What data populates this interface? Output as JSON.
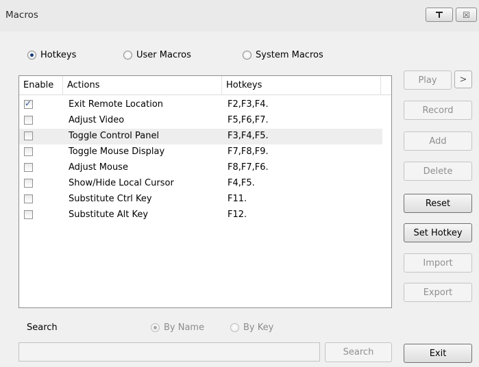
{
  "window": {
    "title": "Macros",
    "pin_icon": "pin-icon",
    "close_icon": "close-icon",
    "close_glyph": "☒"
  },
  "mode_options": [
    {
      "label": "Hotkeys",
      "selected": true
    },
    {
      "label": "User Macros",
      "selected": false
    },
    {
      "label": "System Macros",
      "selected": false
    }
  ],
  "table": {
    "headers": {
      "enable": "Enable",
      "actions": "Actions",
      "hotkeys": "Hotkeys"
    },
    "rows": [
      {
        "enabled": true,
        "action": "Exit Remote Location",
        "hotkeys": "F2,F3,F4."
      },
      {
        "enabled": false,
        "action": "Adjust Video",
        "hotkeys": "F5,F6,F7."
      },
      {
        "enabled": false,
        "action": "Toggle Control Panel",
        "hotkeys": "F3,F4,F5.",
        "highlighted": true
      },
      {
        "enabled": false,
        "action": "Toggle Mouse Display",
        "hotkeys": "F7,F8,F9."
      },
      {
        "enabled": false,
        "action": "Adjust Mouse",
        "hotkeys": "F8,F7,F6."
      },
      {
        "enabled": false,
        "action": "Show/Hide Local Cursor",
        "hotkeys": "F4,F5."
      },
      {
        "enabled": false,
        "action": "Substitute Ctrl Key",
        "hotkeys": "F11."
      },
      {
        "enabled": false,
        "action": "Substitute Alt Key",
        "hotkeys": "F12."
      }
    ]
  },
  "buttons": {
    "play": "Play",
    "play_more": ">",
    "record": "Record",
    "add": "Add",
    "delete": "Delete",
    "reset": "Reset",
    "set_hotkey": "Set Hotkey",
    "import": "Import",
    "export": "Export",
    "exit": "Exit"
  },
  "search": {
    "label": "Search",
    "by_name": "By Name",
    "by_key": "By Key",
    "by_name_selected": true,
    "input_value": "",
    "button": "Search"
  }
}
